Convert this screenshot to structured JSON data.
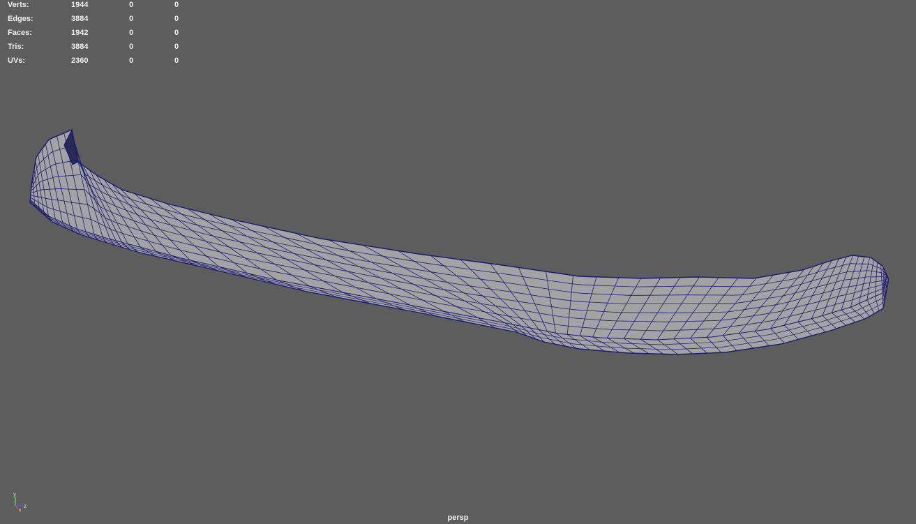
{
  "hud": {
    "rows": [
      {
        "label": "Verts:",
        "total": "1944",
        "selected": "0",
        "extra": "0"
      },
      {
        "label": "Edges:",
        "total": "3884",
        "selected": "0",
        "extra": "0"
      },
      {
        "label": "Faces:",
        "total": "1942",
        "selected": "0",
        "extra": "0"
      },
      {
        "label": "Tris:",
        "total": "3884",
        "selected": "0",
        "extra": "0"
      },
      {
        "label": "UVs:",
        "total": "2360",
        "selected": "0",
        "extra": "0"
      }
    ]
  },
  "viewport": {
    "camera": "persp",
    "background": "#5d5d5d",
    "mesh_fill": "#a3a3a5",
    "wire_color": "#1a1a6e"
  },
  "axis_gizmo": {
    "x_label": "x",
    "y_label": "y",
    "z_label": "z",
    "x_color": "#ff4040",
    "y_color": "#40ff40",
    "z_color": "#4060ff"
  }
}
